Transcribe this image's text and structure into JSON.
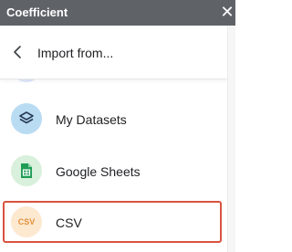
{
  "window": {
    "title": "Coefficient",
    "close_glyph": "✕"
  },
  "header": {
    "title": "Import from..."
  },
  "sources": [
    {
      "label": "My Datasets",
      "icon": "layers-icon",
      "icon_bg": "#b9dcf3",
      "icon_color": "#2a3c57"
    },
    {
      "label": "Google Sheets",
      "icon": "google-sheets-icon",
      "icon_bg": "#d8f0dc",
      "icon_color": "#1f9d55"
    },
    {
      "label": "CSV",
      "icon": "csv-icon",
      "icon_text": "CSV",
      "icon_bg": "#fde8d0",
      "icon_color": "#e0923c",
      "selected": true
    }
  ],
  "colors": {
    "titlebar": "#5f6368",
    "selection_border": "#d9533f"
  }
}
